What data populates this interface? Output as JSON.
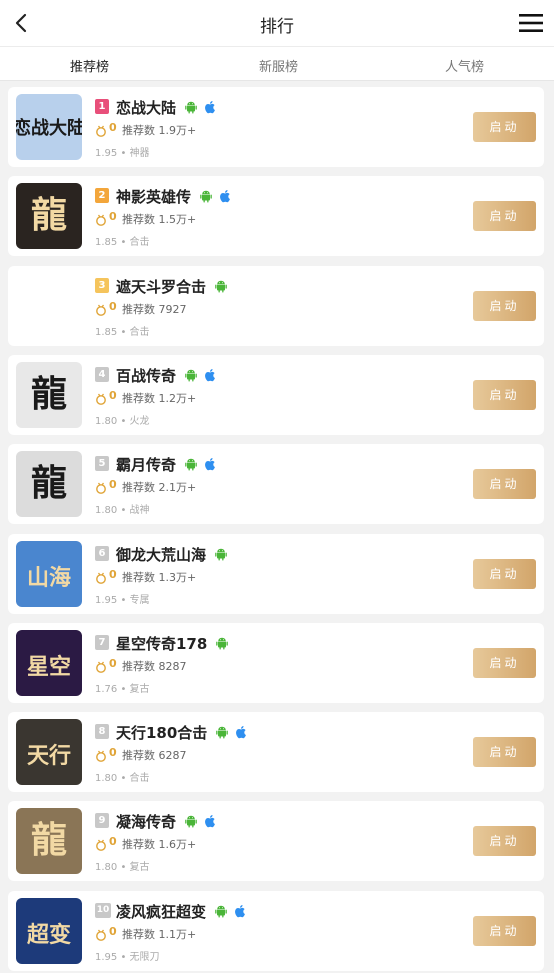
{
  "header": {
    "title": "排行",
    "back_icon": "chevron-left-icon",
    "menu_icon": "hamburger-menu-icon"
  },
  "tabs": [
    {
      "label": "推荐榜",
      "active": true
    },
    {
      "label": "新服榜",
      "active": false
    },
    {
      "label": "人气榜",
      "active": false
    }
  ],
  "rank_colors": {
    "1": "#e84f7a",
    "2": "#f3a63b",
    "3": "#f5c45c",
    "other": "#c8c8c8"
  },
  "games": [
    {
      "rank": "1",
      "name": "恋战大陆",
      "platforms": [
        "android",
        "ios"
      ],
      "coins": "0",
      "recommend": "推荐数 1.9万+",
      "meta": "1.95 • 神器",
      "button": "启动",
      "icon_text": "恋战大陆",
      "icon_bg": "#b8d0ec"
    },
    {
      "rank": "2",
      "name": "神影英雄传",
      "platforms": [
        "android",
        "ios"
      ],
      "coins": "0",
      "recommend": "推荐数 1.5万+",
      "meta": "1.85 • 合击",
      "button": "启动",
      "icon_text": "龍",
      "icon_bg": "#2a2420"
    },
    {
      "rank": "3",
      "name": "遮天斗罗合击",
      "platforms": [
        "android"
      ],
      "coins": "0",
      "recommend": "推荐数 7927",
      "meta": "1.85 • 合击",
      "button": "启动",
      "icon_text": "",
      "icon_bg": "#ffffff"
    },
    {
      "rank": "4",
      "name": "百战传奇",
      "platforms": [
        "android",
        "ios"
      ],
      "coins": "0",
      "recommend": "推荐数 1.2万+",
      "meta": "1.80 • 火龙",
      "button": "启动",
      "icon_text": "龍",
      "icon_bg": "#e8e8e8"
    },
    {
      "rank": "5",
      "name": "霸月传奇",
      "platforms": [
        "android",
        "ios"
      ],
      "coins": "0",
      "recommend": "推荐数 2.1万+",
      "meta": "1.80 • 战神",
      "button": "启动",
      "icon_text": "龍",
      "icon_bg": "#dcdcdc"
    },
    {
      "rank": "6",
      "name": "御龙大荒山海",
      "platforms": [
        "android"
      ],
      "coins": "0",
      "recommend": "推荐数 1.3万+",
      "meta": "1.95 • 专属",
      "button": "启动",
      "icon_text": "山海",
      "icon_bg": "#4a86cf"
    },
    {
      "rank": "7",
      "name": "星空传奇178",
      "platforms": [
        "android"
      ],
      "coins": "0",
      "recommend": "推荐数 8287",
      "meta": "1.76 • 复古",
      "button": "启动",
      "icon_text": "星空",
      "icon_bg": "#2b1a44"
    },
    {
      "rank": "8",
      "name": "天行180合击",
      "platforms": [
        "android",
        "ios"
      ],
      "coins": "0",
      "recommend": "推荐数 6287",
      "meta": "1.80 • 合击",
      "button": "启动",
      "icon_text": "天行",
      "icon_bg": "#3a3630"
    },
    {
      "rank": "9",
      "name": "凝海传奇",
      "platforms": [
        "android",
        "ios"
      ],
      "coins": "0",
      "recommend": "推荐数 1.6万+",
      "meta": "1.80 • 复古",
      "button": "启动",
      "icon_text": "龍",
      "icon_bg": "#8a7556"
    },
    {
      "rank": "10",
      "name": "凌风疯狂超变",
      "platforms": [
        "android",
        "ios"
      ],
      "coins": "0",
      "recommend": "推荐数 1.1万+",
      "meta": "1.95 • 无限刀",
      "button": "启动",
      "icon_text": "超变",
      "icon_bg": "#1d3a7a"
    }
  ]
}
